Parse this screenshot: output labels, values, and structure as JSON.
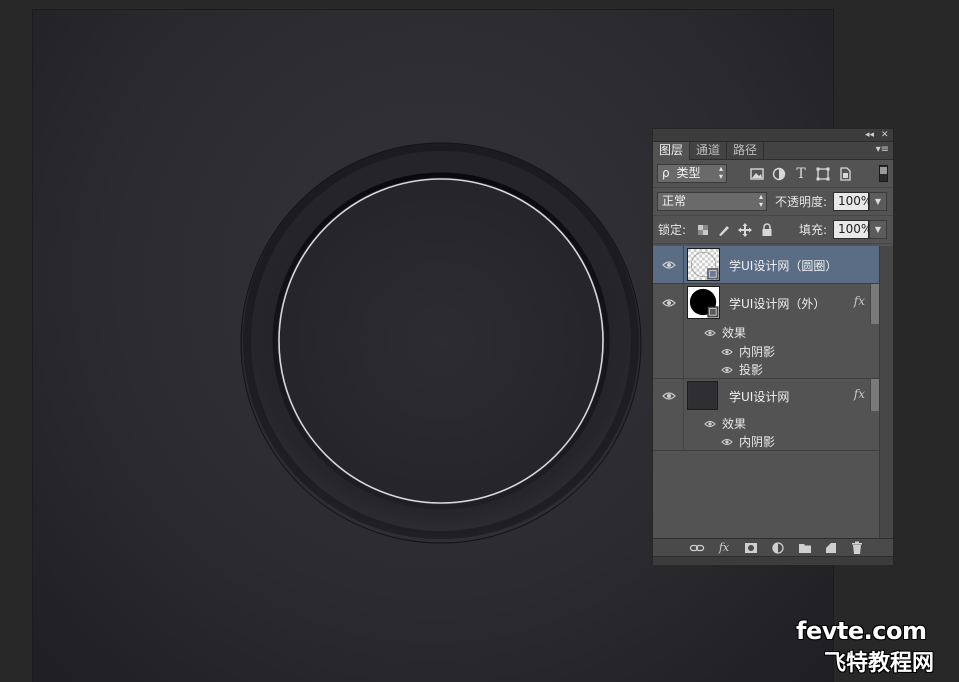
{
  "panel": {
    "collapse_glyph": "◂◂",
    "close_glyph": "✕",
    "menu_glyph": "▾≡",
    "tabs": [
      {
        "label": "图层",
        "active": true
      },
      {
        "label": "通道",
        "active": false
      },
      {
        "label": "路径",
        "active": false
      }
    ],
    "filter": {
      "search_glyph": "ρ",
      "kind_label": "类型",
      "icons": [
        "image-filter-icon",
        "adjustment-filter-icon",
        "type-filter-icon",
        "shape-filter-icon",
        "smart-object-filter-icon"
      ],
      "type_glyph": "T"
    },
    "blend": {
      "mode": "正常",
      "opacity_label": "不透明度:",
      "opacity_value": "100%"
    },
    "lock": {
      "label": "锁定:",
      "fill_label": "填充:",
      "fill_value": "100%"
    },
    "layers": [
      {
        "name": "学UI设计网（圆圈）",
        "selected": true,
        "fx": "",
        "effects_label": "",
        "effects": []
      },
      {
        "name": "学UI设计网（外）",
        "selected": false,
        "fx": "fx",
        "effects_label": "效果",
        "effects": [
          "内阴影",
          "投影"
        ]
      },
      {
        "name": "学UI设计网",
        "selected": false,
        "fx": "fx",
        "effects_label": "效果",
        "effects": [
          "内阴影"
        ]
      }
    ],
    "bottom_icons": [
      "link-layers-icon",
      "layer-style-icon",
      "layer-mask-icon",
      "adjustment-layer-icon",
      "group-folder-icon",
      "new-layer-icon",
      "delete-trash-icon"
    ],
    "bottom_fx_glyph": "fx"
  },
  "watermark": {
    "domain_text": "fevte.com",
    "site_text": "飞特教程网"
  },
  "colors": {
    "panel_bg": "#535353",
    "selected_layer": "#5b6c85",
    "canvas_bg": "#2b2b30"
  }
}
